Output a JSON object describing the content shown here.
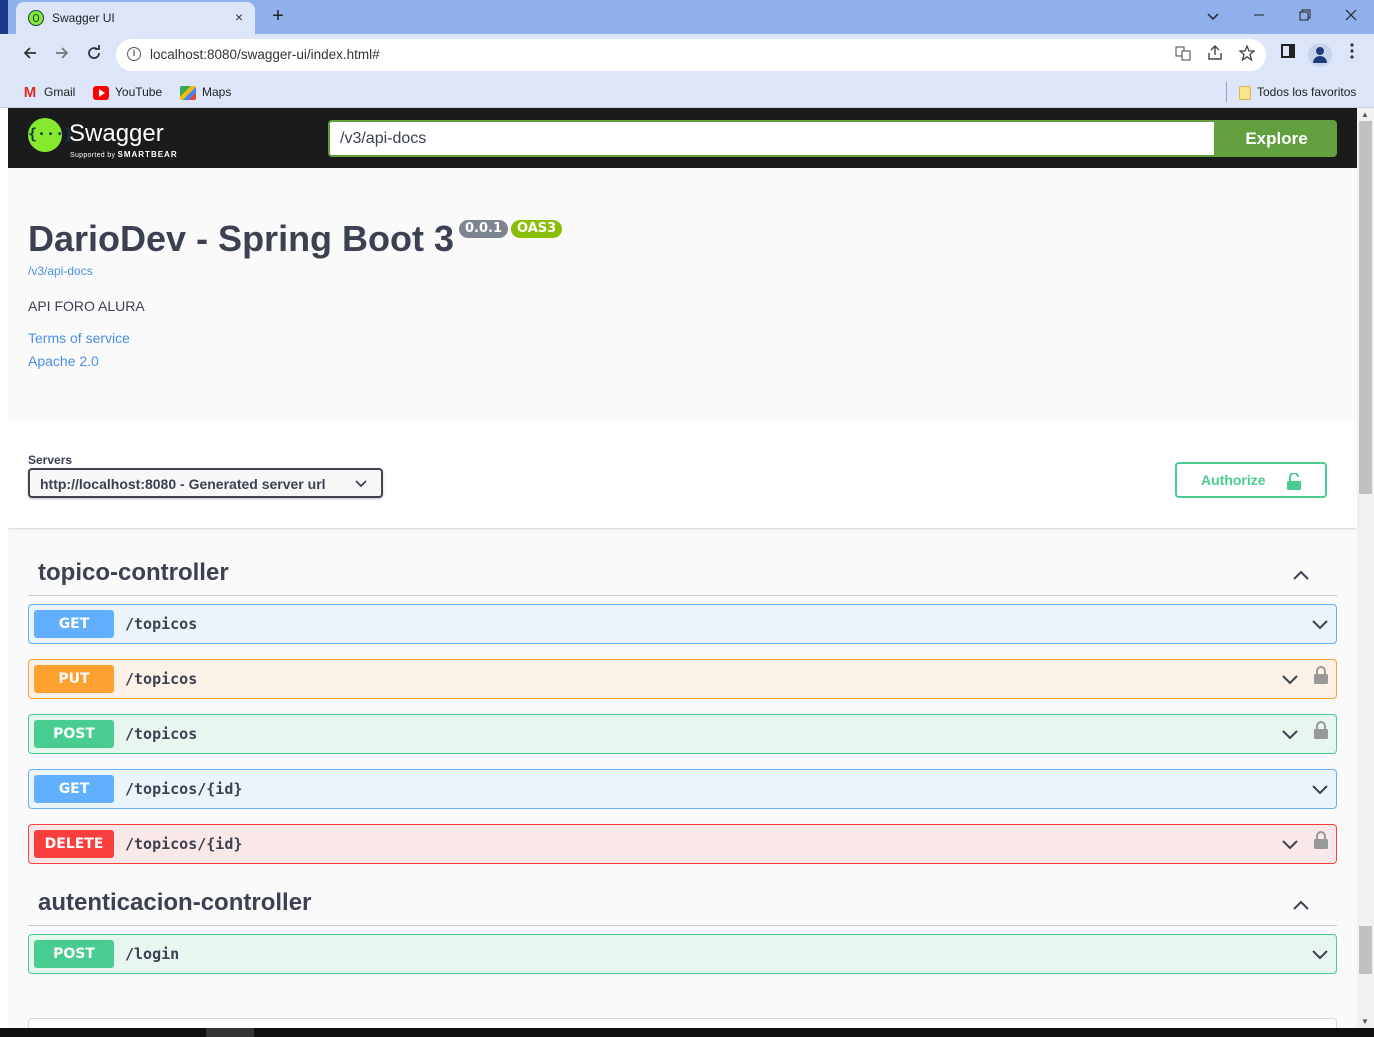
{
  "browser": {
    "tab_title": "Swagger UI",
    "tab_close": "×",
    "new_tab": "+",
    "url": "localhost:8080/swagger-ui/index.html#",
    "icons": [
      "back-icon",
      "forward-icon",
      "reload-icon",
      "info-icon",
      "translate-icon",
      "share-icon",
      "star-icon",
      "sidepanel-icon",
      "profile-icon",
      "menu-icon"
    ]
  },
  "bookmarks": {
    "items": [
      "Gmail",
      "YouTube",
      "Maps"
    ],
    "all_bookmarks": "Todos los favoritos"
  },
  "swagger": {
    "brand": "Swagger",
    "supported_by": "Supported by",
    "smartbear": "SMARTBEAR",
    "spec_url": "/v3/api-docs",
    "explore": "Explore"
  },
  "info": {
    "title": "DarioDev - Spring Boot 3",
    "version": "0.0.1",
    "oas": "OAS3",
    "spec_link": "/v3/api-docs",
    "description": "API FORO ALURA",
    "terms": "Terms of service",
    "license": "Apache 2.0"
  },
  "servers": {
    "label": "Servers",
    "selected": "http://localhost:8080 - Generated server url"
  },
  "authorize": "Authorize",
  "tags": [
    {
      "name": "topico-controller",
      "operations": [
        {
          "method": "GET",
          "path": "/topicos",
          "locked": false
        },
        {
          "method": "PUT",
          "path": "/topicos",
          "locked": true
        },
        {
          "method": "POST",
          "path": "/topicos",
          "locked": true
        },
        {
          "method": "GET",
          "path": "/topicos/{id}",
          "locked": false
        },
        {
          "method": "DELETE",
          "path": "/topicos/{id}",
          "locked": true
        }
      ]
    },
    {
      "name": "autenticacion-controller",
      "operations": [
        {
          "method": "POST",
          "path": "/login",
          "locked": false
        }
      ]
    }
  ],
  "colors": {
    "get": "#61affe",
    "put": "#fca130",
    "post": "#49cc90",
    "delete": "#f93e3e",
    "brand_green": "#62a03f"
  }
}
